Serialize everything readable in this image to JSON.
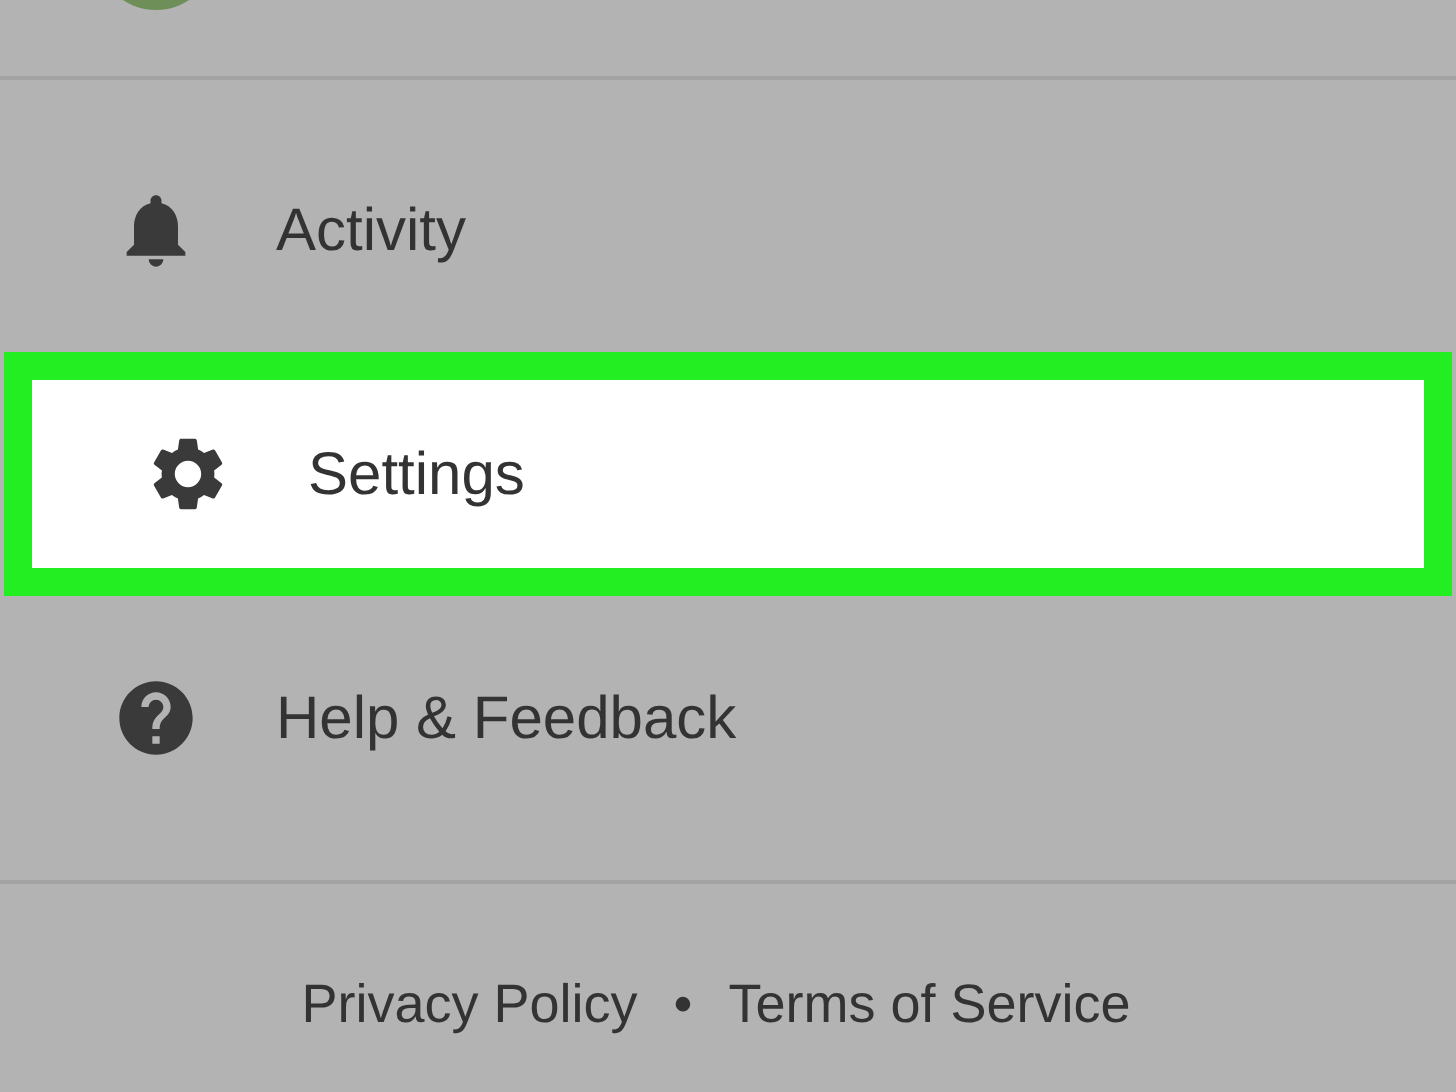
{
  "menu": [
    {
      "kind": "bell",
      "label": "Activity",
      "selected": false
    },
    {
      "kind": "gear",
      "label": "Settings",
      "selected": true
    },
    {
      "kind": "help",
      "label": "Help & Feedback",
      "selected": false
    }
  ],
  "footer": {
    "links": [
      "Privacy Policy",
      "Terms of Service"
    ],
    "separator": "•"
  }
}
